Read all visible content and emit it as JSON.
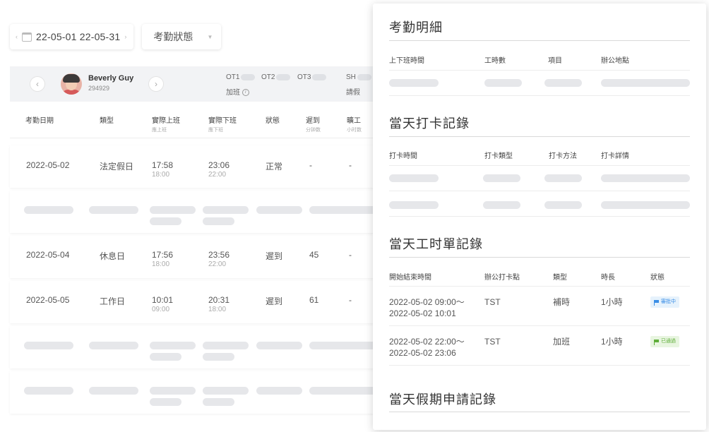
{
  "filters": {
    "date_range": "22-05-01 22-05-31",
    "status_placeholder": "考勤狀態"
  },
  "user": {
    "name": "Beverly Guy",
    "id": "294929"
  },
  "summary": {
    "ot1": "OT1",
    "ot2": "OT2",
    "ot3": "OT3",
    "overtime": "加班",
    "sh": "SH",
    "leave": "請假"
  },
  "columns": [
    {
      "label": "考勤日期",
      "sub": ""
    },
    {
      "label": "類型",
      "sub": ""
    },
    {
      "label": "實際上班",
      "sub": "應上班"
    },
    {
      "label": "實際下班",
      "sub": "應下班"
    },
    {
      "label": "狀態",
      "sub": ""
    },
    {
      "label": "遲到",
      "sub": "分钟数"
    },
    {
      "label": "曠工",
      "sub": "小时数"
    }
  ],
  "rows": [
    {
      "date": "2022-05-02",
      "type": "法定假日",
      "clock_in": "17:58",
      "sched_in": "18:00",
      "clock_out": "23:06",
      "sched_out": "22:00",
      "status": "正常",
      "late": "-",
      "absent": "-"
    },
    {
      "date": "2022-05-04",
      "type": "休息日",
      "clock_in": "17:56",
      "sched_in": "18:00",
      "clock_out": "23:56",
      "sched_out": "22:00",
      "status": "遲到",
      "late": "45",
      "absent": "-"
    },
    {
      "date": "2022-05-05",
      "type": "工作日",
      "clock_in": "10:01",
      "sched_in": "09:00",
      "clock_out": "20:31",
      "sched_out": "18:00",
      "status": "遲到",
      "late": "61",
      "absent": "-"
    }
  ],
  "panel": {
    "detail": {
      "title": "考勤明細",
      "headers": [
        "上下班時間",
        "工時數",
        "項目",
        "辦公地點"
      ]
    },
    "punch": {
      "title": "當天打卡記錄",
      "headers": [
        "打卡時間",
        "打卡類型",
        "打卡方法",
        "打卡詳情"
      ]
    },
    "timesheet": {
      "title": "當天工时單記錄",
      "headers": [
        "開始結束時間",
        "辦公打卡點",
        "類型",
        "時長",
        "狀態"
      ],
      "rows": [
        {
          "start": "2022-05-02 09:00～",
          "end": "2022-05-02 10:01",
          "location": "TST",
          "type": "補時",
          "duration": "1小時",
          "status": "審批中",
          "status_color": "#3a8ee6"
        },
        {
          "start": "2022-05-02 22:00～",
          "end": "2022-05-02 23:06",
          "location": "TST",
          "type": "加班",
          "duration": "1小時",
          "status": "已通過",
          "status_color": "#5fae3a"
        }
      ]
    },
    "leave": {
      "title": "當天假期申請記錄"
    }
  }
}
